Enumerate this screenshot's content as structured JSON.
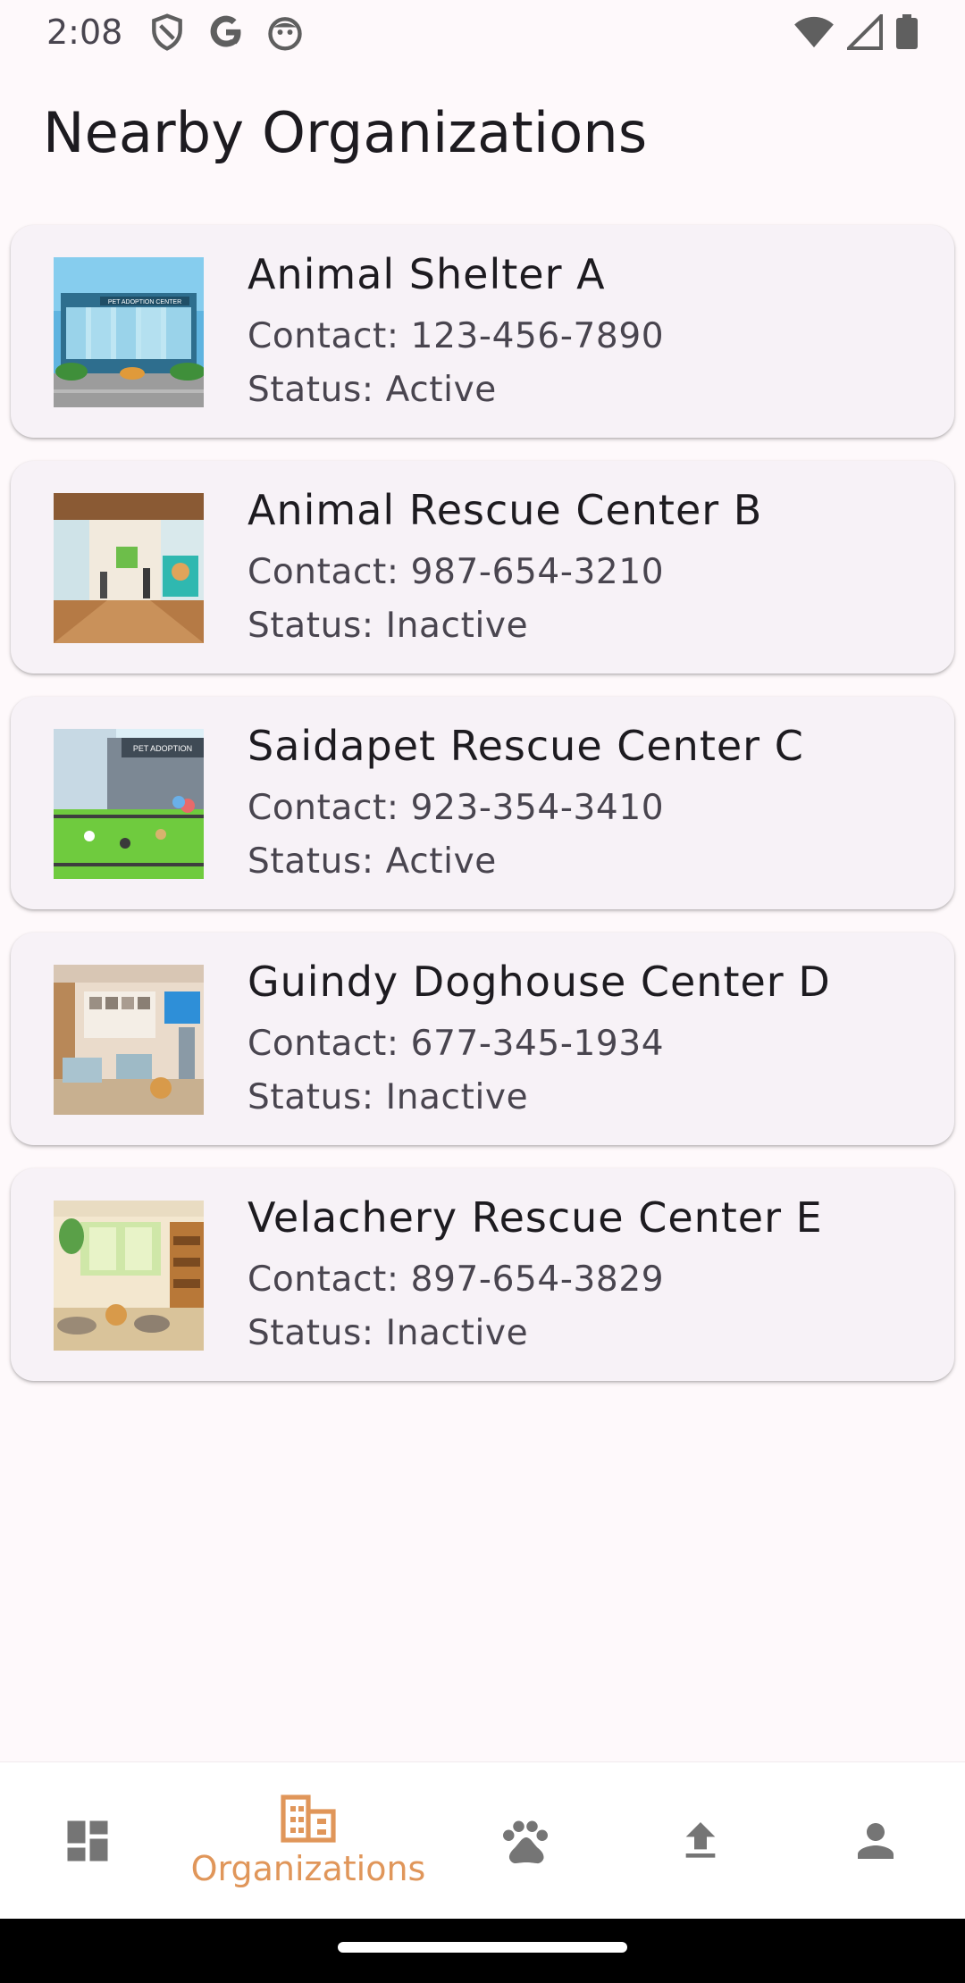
{
  "status_bar": {
    "time": "2:08",
    "left_icons": [
      "shield-icon",
      "google-icon",
      "android-face-icon"
    ],
    "right_icons": [
      "wifi-icon",
      "cellular-signal-icon",
      "battery-icon"
    ]
  },
  "header": {
    "title": "Nearby Organizations"
  },
  "organizations": [
    {
      "name": "Animal Shelter A",
      "contact": "Contact: 123-456-7890",
      "status": "Status: Active",
      "image_text": "PET ADOPTION CENTER"
    },
    {
      "name": "Animal Rescue Center B",
      "contact": "Contact: 987-654-3210",
      "status": "Status: Inactive"
    },
    {
      "name": "Saidapet Rescue Center C",
      "contact": "Contact: 923-354-3410",
      "status": "Status: Active",
      "image_text": "PET ADOPTION"
    },
    {
      "name": "Guindy Doghouse Center D",
      "contact": "Contact: 677-345-1934",
      "status": "Status: Inactive"
    },
    {
      "name": "Velachery Rescue Center E",
      "contact": "Contact: 897-654-3829",
      "status": "Status: Inactive"
    }
  ],
  "bottom_nav": {
    "items": [
      {
        "icon": "dashboard-icon",
        "label": "",
        "active": false
      },
      {
        "icon": "organizations-icon",
        "label": "Organizations",
        "active": true
      },
      {
        "icon": "paw-icon",
        "label": "",
        "active": false
      },
      {
        "icon": "upload-icon",
        "label": "",
        "active": false
      },
      {
        "icon": "person-icon",
        "label": "",
        "active": false
      }
    ]
  },
  "colors": {
    "background": "#FEF9FB",
    "card": "#F7F2F7",
    "accent": "#E0965A",
    "icon_inactive": "#757575",
    "text_primary": "#1D1B20",
    "text_secondary": "#49454F"
  }
}
